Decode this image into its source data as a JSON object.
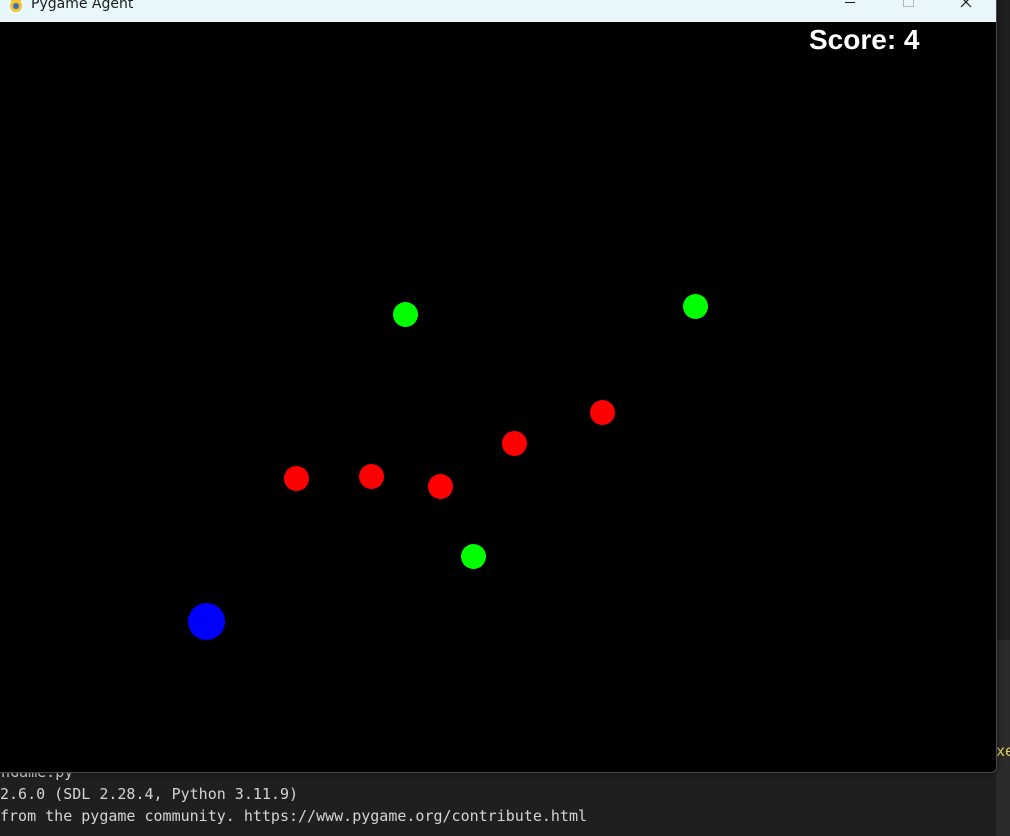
{
  "window": {
    "title": "Pygame Agent",
    "icon": "pygame-snake-icon",
    "controls": {
      "minimize": "minimize-icon",
      "maximize": "maximize-icon",
      "close": "close-icon"
    }
  },
  "game": {
    "score_text": "Score: 4",
    "background_color": "#000000",
    "player": {
      "color": "#0000ff"
    },
    "food": {
      "color": "#00ff00",
      "count": 3
    },
    "enemies": {
      "color": "#ff0000",
      "count": 5
    }
  },
  "terminal": {
    "lines": [
      "onGame.py",
      " 2.6.0 (SDL 2.28.4, Python 3.11.9)",
      "from the pygame community. https://www.pygame.org/contribute.html"
    ],
    "edge_text": "xe"
  }
}
